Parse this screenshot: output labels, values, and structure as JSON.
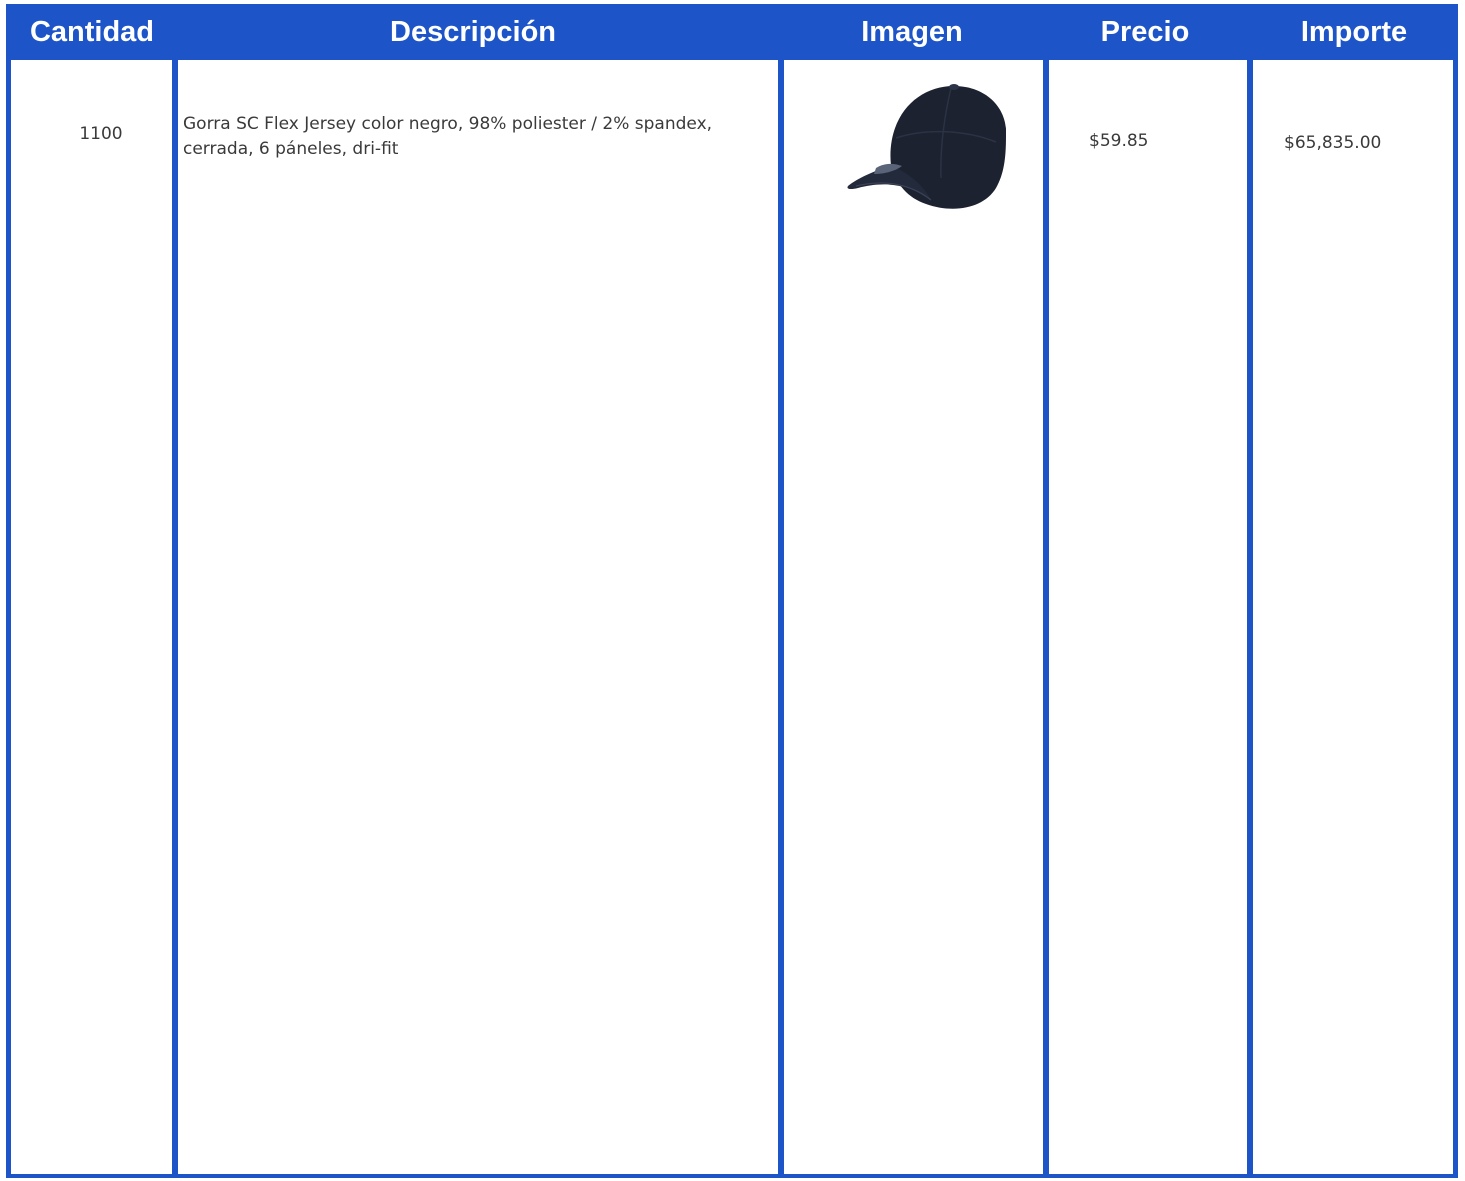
{
  "table": {
    "headers": {
      "cantidad": "Cantidad",
      "descripcion": "Descripción",
      "imagen": "Imagen",
      "precio": "Precio",
      "importe": "Importe"
    },
    "rows": [
      {
        "cantidad": "1100",
        "descripcion": "Gorra SC Flex Jersey color negro, 98% poliester / 2% spandex, cerrada, 6 páneles, dri-fit",
        "imagen": "cap-image",
        "precio": "$59.85",
        "importe": "$65,835.00"
      }
    ]
  },
  "colors": {
    "header_bg": "#1d54c8",
    "header_text": "#ffffff",
    "cell_text": "#3a3a3a",
    "cap": "#1c2230"
  }
}
